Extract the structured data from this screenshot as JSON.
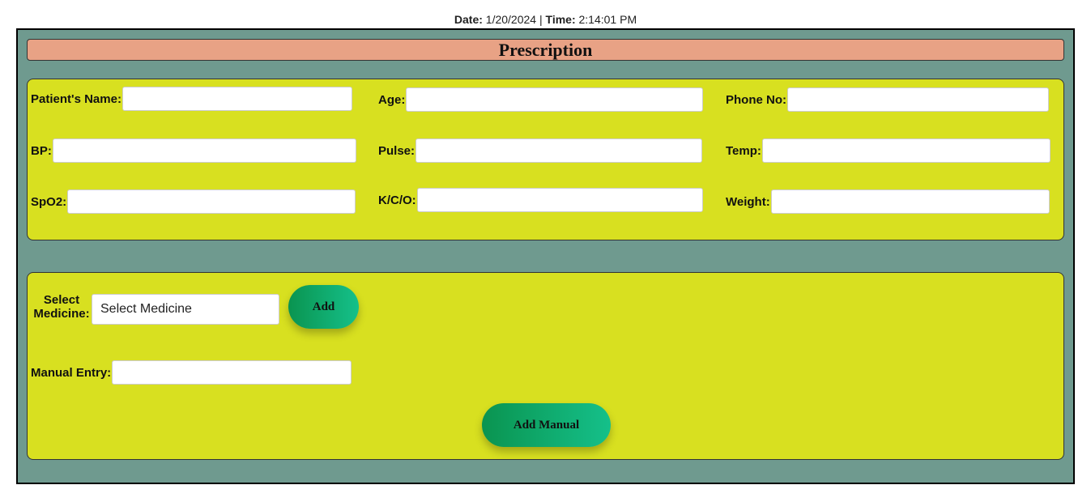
{
  "header": {
    "date_label": "Date:",
    "date_value": "1/20/2024",
    "separator": "|",
    "time_label": "Time:",
    "time_value": "2:14:01 PM"
  },
  "form": {
    "title": "Prescription",
    "vitals": {
      "patient_name": {
        "label": "Patient's Name:",
        "value": ""
      },
      "age": {
        "label": "Age:",
        "value": ""
      },
      "phone": {
        "label": "Phone No:",
        "value": ""
      },
      "bp": {
        "label": "BP:",
        "value": ""
      },
      "pulse": {
        "label": "Pulse:",
        "value": ""
      },
      "temp": {
        "label": "Temp:",
        "value": ""
      },
      "spo2": {
        "label": "SpO2:",
        "value": ""
      },
      "kco": {
        "label": "K/C/O:",
        "value": ""
      },
      "weight": {
        "label": "Weight:",
        "value": ""
      }
    },
    "medicine": {
      "select_label_line1": "Select",
      "select_label_line2": "Medicine:",
      "select_value": "Select Medicine",
      "add_label": "Add",
      "manual_label": "Manual Entry:",
      "manual_value": "",
      "add_manual_label": "Add Manual"
    }
  },
  "colors": {
    "frame_bg": "#6f9a8f",
    "title_bg": "#e8a285",
    "panel_bg": "#d8e020",
    "button_gradient_start": "#0a9450",
    "button_gradient_end": "#15c08a"
  }
}
